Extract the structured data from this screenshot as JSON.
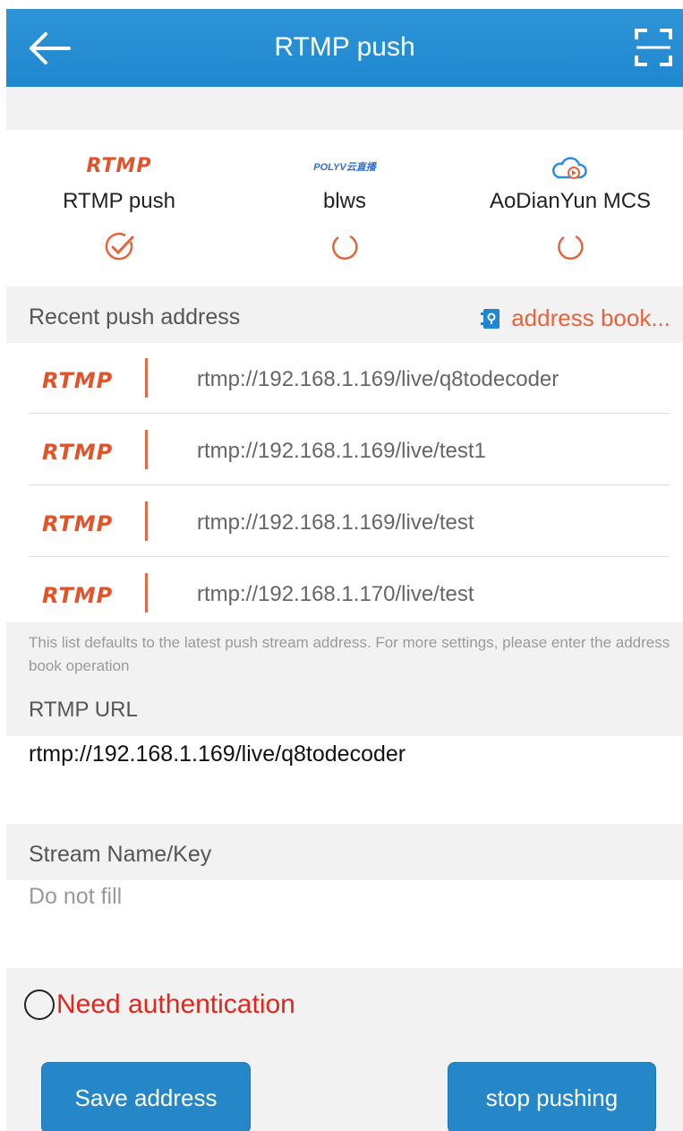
{
  "header": {
    "title": "RTMP push",
    "back_icon": "arrow-left-icon",
    "scan_icon": "scan-frame-icon"
  },
  "platforms": [
    {
      "logo_text": "RTMP",
      "name": "RTMP push",
      "selected": true
    },
    {
      "logo_text": "POLYV云直播",
      "name": "blws",
      "selected": false
    },
    {
      "logo_text": "",
      "logo_icon": "cloud-play-icon",
      "name": "AoDianYun MCS",
      "selected": false
    }
  ],
  "recent": {
    "label": "Recent push address",
    "address_book_label": "address book...",
    "items": [
      {
        "badge": "RTMP",
        "url": "rtmp://192.168.1.169/live/q8todecoder"
      },
      {
        "badge": "RTMP",
        "url": "rtmp://192.168.1.169/live/test1"
      },
      {
        "badge": "RTMP",
        "url": "rtmp://192.168.1.169/live/test"
      },
      {
        "badge": "RTMP",
        "url": "rtmp://192.168.1.170/live/test"
      }
    ]
  },
  "hint": "This list defaults to the latest push stream address. For more settings, please enter the address book operation",
  "rtmp_url": {
    "label": "RTMP URL",
    "value": "rtmp://192.168.1.169/live/q8todecoder"
  },
  "stream_key": {
    "label": "Stream Name/Key",
    "placeholder": "Do not fill",
    "value": ""
  },
  "auth": {
    "label": "Need authentication",
    "checked": false
  },
  "buttons": {
    "save": "Save address",
    "stop": "stop pushing"
  },
  "colors": {
    "header": "#1f87cf",
    "accent": "#e8623a",
    "button": "#2586c8",
    "auth": "#e3261b"
  }
}
